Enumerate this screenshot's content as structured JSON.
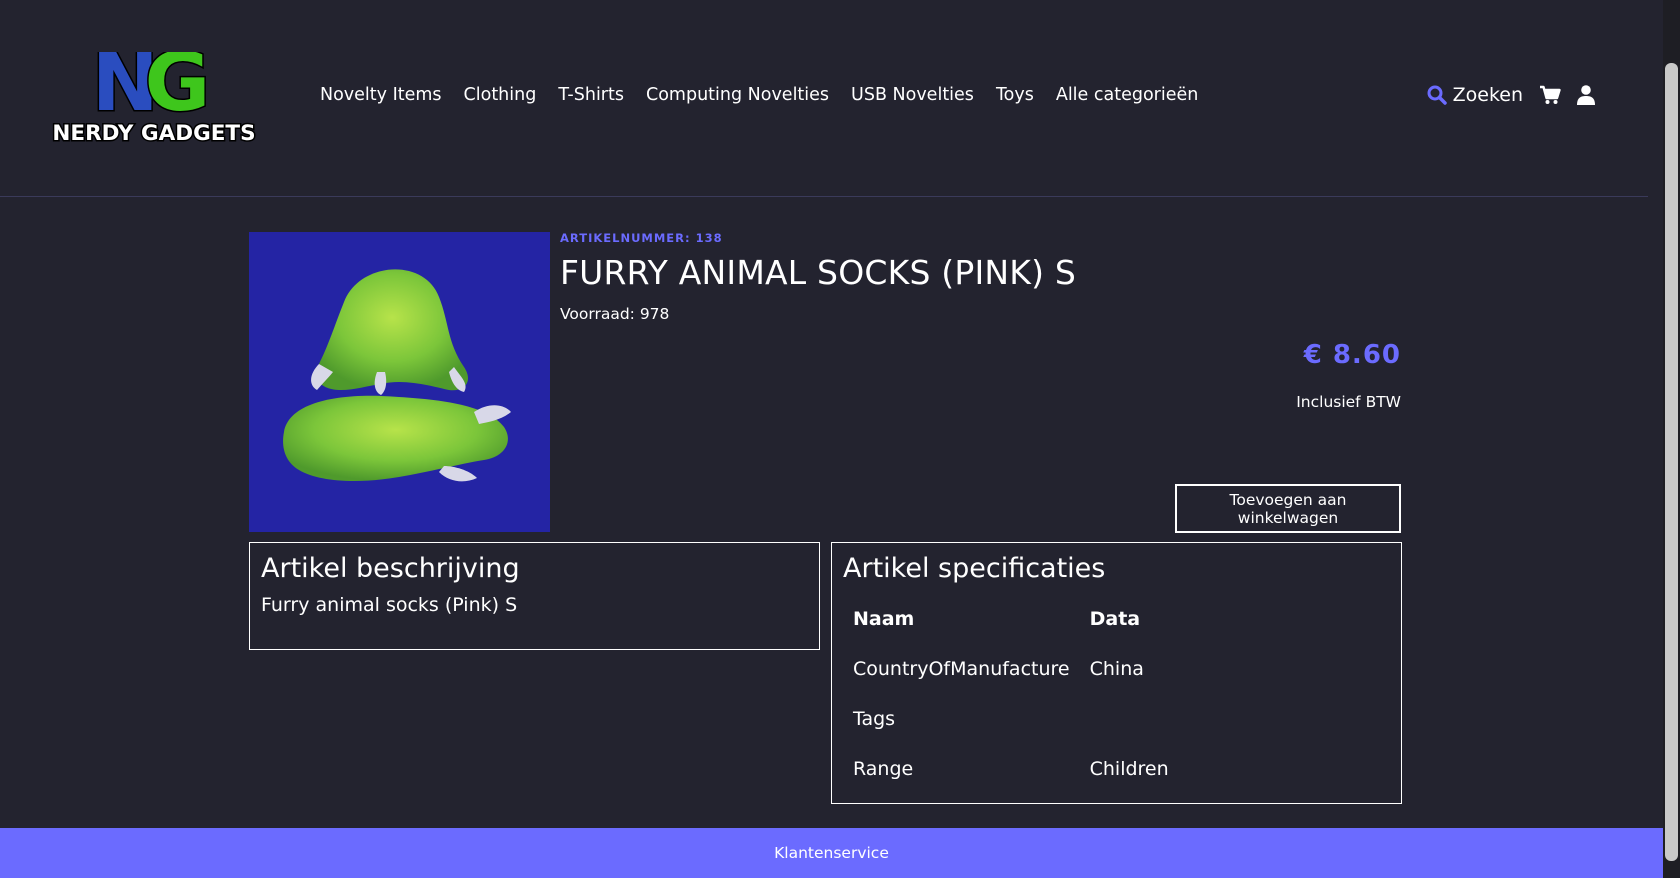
{
  "brand": {
    "logo_letters": "NG",
    "name": "NERDY GADGETS",
    "colors": {
      "n": "#2a4dbf",
      "g": "#3ec61c"
    }
  },
  "nav": {
    "items": [
      {
        "label": "Novelty Items"
      },
      {
        "label": "Clothing"
      },
      {
        "label": "T-Shirts"
      },
      {
        "label": "Computing Novelties"
      },
      {
        "label": "USB Novelties"
      },
      {
        "label": "Toys"
      },
      {
        "label": "Alle categorieën"
      }
    ],
    "search_label": "Zoeken"
  },
  "product": {
    "article_number": "ARTIKELNUMMER: 138",
    "title": "FURRY ANIMAL SOCKS (PINK) S",
    "stock": "Voorraad: 978",
    "price": "€ 8.60",
    "vat_note": "Inclusief BTW",
    "add_to_cart_label": "Toevoegen aan winkelwagen"
  },
  "description": {
    "heading": "Artikel beschrijving",
    "text": "Furry animal socks (Pink) S"
  },
  "specifications": {
    "heading": "Artikel specificaties",
    "columns": [
      "Naam",
      "Data"
    ],
    "rows": [
      [
        "CountryOfManufacture",
        "China"
      ],
      [
        "Tags",
        ""
      ],
      [
        "Range",
        "Children"
      ]
    ]
  },
  "footer": {
    "label": "Klantenservice"
  },
  "colors": {
    "background": "#23232f",
    "accent": "#6b6bff",
    "image_bg": "#2424a4"
  }
}
